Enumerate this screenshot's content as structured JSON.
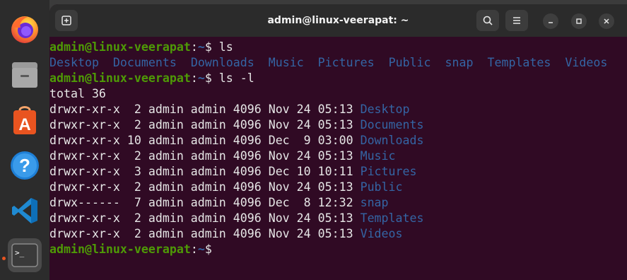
{
  "window": {
    "title": "admin@linux-veerapat: ~"
  },
  "prompt": {
    "user_host": "admin@linux-veerapat",
    "sep": ":",
    "path": "~",
    "dollar": "$ "
  },
  "cmd1": "ls",
  "ls_short": [
    "Desktop",
    "Documents",
    "Downloads",
    "Music",
    "Pictures",
    "Public",
    "snap",
    "Templates",
    "Videos"
  ],
  "cmd2": "ls -l",
  "total": "total 36",
  "ls_long": [
    {
      "meta": "drwxr-xr-x  2 admin admin 4096 Nov 24 05:13 ",
      "name": "Desktop"
    },
    {
      "meta": "drwxr-xr-x  2 admin admin 4096 Nov 24 05:13 ",
      "name": "Documents"
    },
    {
      "meta": "drwxr-xr-x 10 admin admin 4096 Dec  9 03:00 ",
      "name": "Downloads"
    },
    {
      "meta": "drwxr-xr-x  2 admin admin 4096 Nov 24 05:13 ",
      "name": "Music"
    },
    {
      "meta": "drwxr-xr-x  3 admin admin 4096 Dec 10 10:11 ",
      "name": "Pictures"
    },
    {
      "meta": "drwxr-xr-x  2 admin admin 4096 Nov 24 05:13 ",
      "name": "Public"
    },
    {
      "meta": "drwx------  7 admin admin 4096 Dec  8 12:32 ",
      "name": "snap"
    },
    {
      "meta": "drwxr-xr-x  2 admin admin 4096 Nov 24 05:13 ",
      "name": "Templates"
    },
    {
      "meta": "drwxr-xr-x  2 admin admin 4096 Nov 24 05:13 ",
      "name": "Videos"
    }
  ],
  "colors": {
    "terminal_bg": "#300a24",
    "prompt_user": "#4e9a06",
    "dir": "#3465a4",
    "text": "#e6e6e6"
  },
  "dock": [
    "firefox-icon",
    "files-icon",
    "app-center-icon",
    "help-icon",
    "vscode-icon",
    "terminal-icon"
  ]
}
